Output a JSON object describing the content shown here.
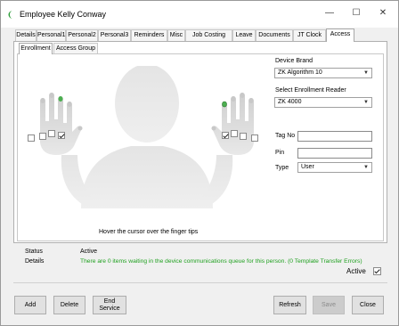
{
  "window": {
    "title": "Employee Kelly Conway",
    "minimize_glyph": "—",
    "maximize_glyph": "☐",
    "close_glyph": "✕"
  },
  "tabs": [
    {
      "label": "Details"
    },
    {
      "label": "Personal1"
    },
    {
      "label": "Personal2"
    },
    {
      "label": "Personal3"
    },
    {
      "label": "Reminders"
    },
    {
      "label": "Misc"
    },
    {
      "label": "Job Costing"
    },
    {
      "label": "Leave"
    },
    {
      "label": "Documents"
    },
    {
      "label": "JT Clock"
    },
    {
      "label": "Access"
    }
  ],
  "active_tab": "Access",
  "subtabs": [
    {
      "label": "Enrollment"
    },
    {
      "label": "Access Group"
    }
  ],
  "active_subtab": "Enrollment",
  "enrollment": {
    "hint": "Hover the cursor over the finger tips",
    "left_hand_checked": true,
    "right_hand_checked": true,
    "highlight_color": "#4caf50"
  },
  "device": {
    "brand_label": "Device Brand",
    "brand_value": "ZK Algorithm 10",
    "reader_label": "Select Enrollment Reader",
    "reader_value": "ZK 4000",
    "tag_label": "Tag No",
    "tag_value": "",
    "pin_label": "Pin",
    "pin_value": "",
    "type_label": "Type",
    "type_value": "User"
  },
  "status": {
    "status_label": "Status",
    "status_value": "Active",
    "details_label": "Details",
    "details_value": "There are 0 items waiting in the device communications queue for this person. (0 Template Transfer Errors)",
    "active_label": "Active",
    "active_checked": true
  },
  "buttons": {
    "add": "Add",
    "delete": "Delete",
    "end_service_line1": "End",
    "end_service_line2": "Service",
    "refresh": "Refresh",
    "save": "Save",
    "close": "Close"
  }
}
